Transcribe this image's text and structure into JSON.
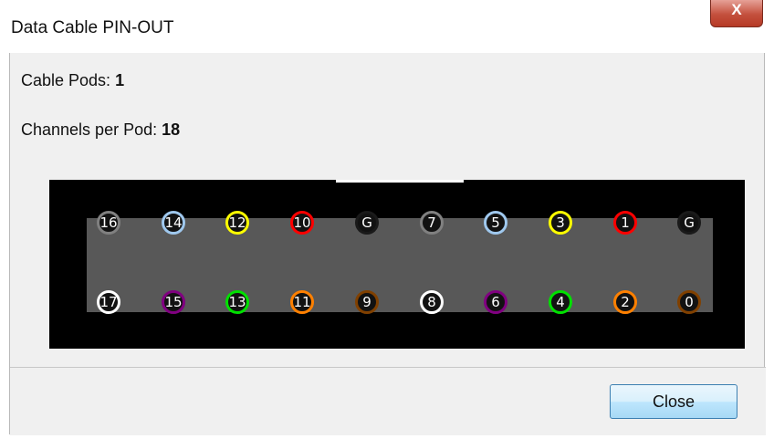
{
  "window": {
    "title": "Data Cable PIN-OUT",
    "close_glyph": "X"
  },
  "info": {
    "cable_pods_label": "Cable Pods:",
    "cable_pods_value": "1",
    "channels_label": "Channels per Pod:",
    "channels_value": "18"
  },
  "pins": {
    "top_row": [
      {
        "label": "16",
        "color": "#808080"
      },
      {
        "label": "14",
        "color": "#9fc8ee"
      },
      {
        "label": "12",
        "color": "#ffff00"
      },
      {
        "label": "10",
        "color": "#ff0000"
      },
      {
        "label": "G",
        "color": "#1a1a1a"
      },
      {
        "label": "7",
        "color": "#808080"
      },
      {
        "label": "5",
        "color": "#9fc8ee"
      },
      {
        "label": "3",
        "color": "#ffff00"
      },
      {
        "label": "1",
        "color": "#ff0000"
      },
      {
        "label": "G",
        "color": "#1a1a1a"
      }
    ],
    "bottom_row": [
      {
        "label": "17",
        "color": "#ffffff"
      },
      {
        "label": "15",
        "color": "#800080"
      },
      {
        "label": "13",
        "color": "#00e000"
      },
      {
        "label": "11",
        "color": "#ff8000"
      },
      {
        "label": "9",
        "color": "#804000"
      },
      {
        "label": "8",
        "color": "#ffffff"
      },
      {
        "label": "6",
        "color": "#800080"
      },
      {
        "label": "4",
        "color": "#00e000"
      },
      {
        "label": "2",
        "color": "#ff8000"
      },
      {
        "label": "0",
        "color": "#804000"
      }
    ]
  },
  "buttons": {
    "close_label": "Close"
  }
}
